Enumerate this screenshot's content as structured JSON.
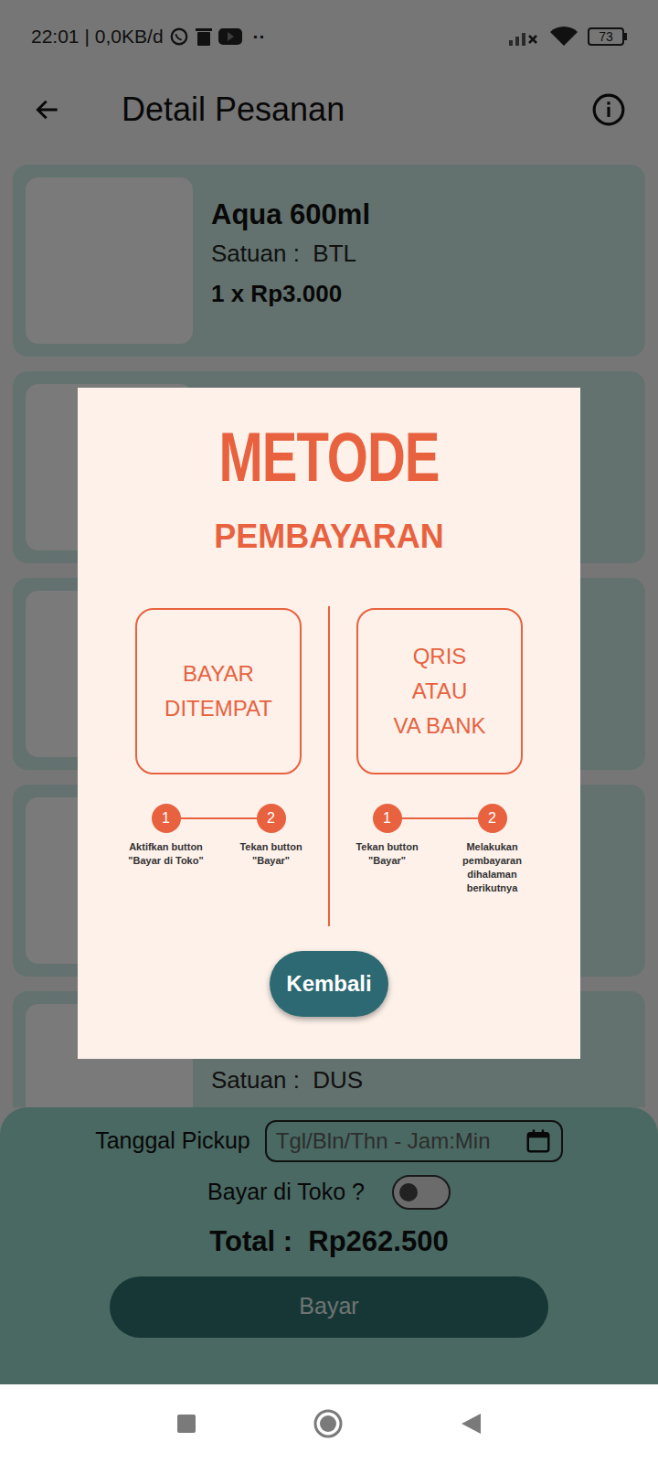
{
  "status_bar": {
    "time": "22:01",
    "speed": "| 0,0KB/d",
    "more": "··",
    "battery": "73"
  },
  "app_bar": {
    "title": "Detail Pesanan"
  },
  "items": [
    {
      "title": "Aqua 600ml",
      "unit": "Satuan :  BTL",
      "qty_price": "1 x Rp3.000"
    },
    {},
    {},
    {},
    {
      "unit": "Satuan :  DUS"
    }
  ],
  "checkout": {
    "pickup_label": "Tanggal Pickup",
    "pickup_placeholder": "Tgl/Bln/Thn - Jam:Min",
    "pay_at_store_label": "Bayar di Toko ?",
    "pay_at_store_on": false,
    "total": "Total :  Rp262.500",
    "pay_button": "Bayar"
  },
  "dialog": {
    "title": "METODE",
    "subtitle": "PEMBAYARAN",
    "methods": [
      {
        "label": "BAYAR\nDITEMPAT",
        "steps": [
          {
            "number": "1",
            "caption": "Aktifkan button \"Bayar di Toko\""
          },
          {
            "number": "2",
            "caption": "Tekan button \"Bayar\""
          }
        ]
      },
      {
        "label": "QRIS\nATAU\nVA BANK",
        "steps": [
          {
            "number": "1",
            "caption": "Tekan button \"Bayar\""
          },
          {
            "number": "2",
            "caption": "Melakukan pembayaran dihalaman berikutnya"
          }
        ]
      }
    ],
    "button": "Kembali"
  }
}
